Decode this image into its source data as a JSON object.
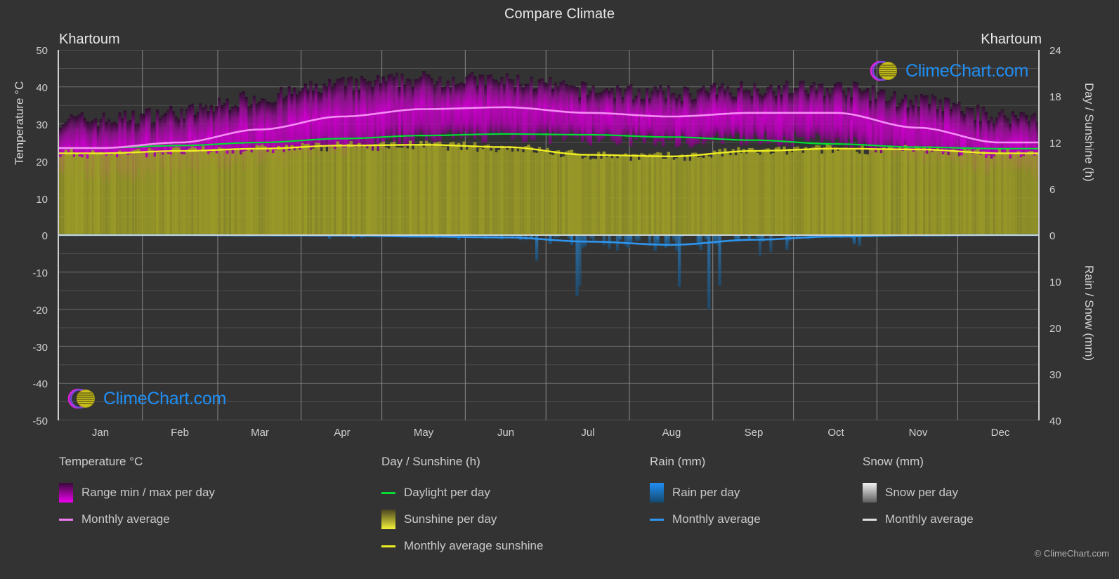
{
  "header": {
    "title": "Compare Climate",
    "location_left": "Khartoum",
    "location_right": "Khartoum"
  },
  "watermark": {
    "text": "ClimeChart.com",
    "copyright": "© ClimeChart.com"
  },
  "axes": {
    "left_label": "Temperature °C",
    "right_label_top": "Day / Sunshine (h)",
    "right_label_bottom": "Rain / Snow (mm)",
    "left_ticks": [
      "50",
      "40",
      "30",
      "20",
      "10",
      "0",
      "-10",
      "-20",
      "-30",
      "-40",
      "-50"
    ],
    "right_ticks_top": [
      "24",
      "18",
      "12",
      "6",
      "0"
    ],
    "right_ticks_bottom": [
      "10",
      "20",
      "30",
      "40"
    ],
    "x_ticks": [
      "Jan",
      "Feb",
      "Mar",
      "Apr",
      "May",
      "Jun",
      "Jul",
      "Aug",
      "Sep",
      "Oct",
      "Nov",
      "Dec"
    ]
  },
  "legend": {
    "temperature": {
      "heading": "Temperature °C",
      "items": [
        {
          "label": "Range min / max per day",
          "type": "swatch",
          "color": "#ee00ee"
        },
        {
          "label": "Monthly average",
          "type": "line",
          "color": "#f07cf0"
        }
      ]
    },
    "day_sunshine": {
      "heading": "Day / Sunshine (h)",
      "items": [
        {
          "label": "Daylight per day",
          "type": "line",
          "color": "#00dd33"
        },
        {
          "label": "Sunshine per day",
          "type": "swatch",
          "color": "#eeee22"
        },
        {
          "label": "Monthly average sunshine",
          "type": "line",
          "color": "#eeee22"
        }
      ]
    },
    "rain": {
      "heading": "Rain (mm)",
      "items": [
        {
          "label": "Rain per day",
          "type": "swatch",
          "color": "#1f8ff5"
        },
        {
          "label": "Monthly average",
          "type": "line",
          "color": "#2f95ee"
        }
      ]
    },
    "snow": {
      "heading": "Snow (mm)",
      "items": [
        {
          "label": "Snow per day",
          "type": "swatch",
          "color": "#e8e8e8"
        },
        {
          "label": "Monthly average",
          "type": "line",
          "color": "#e0e0e0"
        }
      ]
    }
  },
  "colors": {
    "background": "#333333",
    "grid": "#6e6e6e",
    "axis": "#cfcfcf",
    "temp_band": "#cc00cc",
    "temp_avg": "#f58ef5",
    "daylight": "#00dd33",
    "sunshine_fill": "#999922",
    "sunshine_avg": "#eeee22",
    "rain": "#1f6fae",
    "rain_avg": "#2f95ee",
    "logo_blue": "#1f8ff5",
    "logo_magenta": "#e020e0",
    "logo_yellow": "#d8d020"
  },
  "chart_data": {
    "type": "area",
    "title": "Compare Climate",
    "xlabel": "",
    "ylabel": "Temperature °C",
    "ylim": [
      -50,
      50
    ],
    "ylim_right_hours": [
      0,
      24
    ],
    "ylim_right_precip": [
      0,
      40
    ],
    "grid": true,
    "legend_position": "below",
    "categories": [
      "Jan",
      "Feb",
      "Mar",
      "Apr",
      "May",
      "Jun",
      "Jul",
      "Aug",
      "Sep",
      "Oct",
      "Nov",
      "Dec"
    ],
    "series": [
      {
        "name": "Monthly average temperature (°C)",
        "unit": "°C",
        "color": "#f58ef5",
        "values": [
          23.5,
          25.0,
          28.5,
          32.0,
          34.0,
          34.5,
          33.0,
          32.0,
          33.0,
          33.0,
          29.0,
          25.0
        ]
      },
      {
        "name": "Daily maximum temperature (°C)",
        "unit": "°C",
        "color": "#cc00cc",
        "values": [
          31.0,
          33.0,
          37.0,
          40.5,
          42.0,
          41.5,
          39.0,
          38.0,
          39.5,
          39.5,
          36.0,
          32.0
        ]
      },
      {
        "name": "Daily minimum temperature (°C)",
        "unit": "°C",
        "color": "#cc00cc",
        "values": [
          15.5,
          16.5,
          19.5,
          23.0,
          26.0,
          27.0,
          26.0,
          25.5,
          26.0,
          25.5,
          21.0,
          17.0
        ]
      },
      {
        "name": "Daylight per day (h)",
        "unit": "h",
        "color": "#00dd33",
        "values": [
          11.3,
          11.6,
          12.0,
          12.5,
          12.9,
          13.1,
          13.0,
          12.7,
          12.3,
          11.8,
          11.4,
          11.2
        ]
      },
      {
        "name": "Monthly average sunshine (h)",
        "unit": "h",
        "color": "#eeee22",
        "values": [
          10.6,
          10.9,
          11.2,
          11.6,
          11.7,
          11.4,
          10.4,
          10.2,
          10.9,
          11.2,
          11.1,
          10.6
        ]
      },
      {
        "name": "Monthly average rain (mm/day)",
        "unit": "mm",
        "color": "#2f95ee",
        "values": [
          0.0,
          0.0,
          0.05,
          0.1,
          0.3,
          0.5,
          1.4,
          2.1,
          1.0,
          0.3,
          0.05,
          0.0
        ]
      },
      {
        "name": "Monthly average snow (mm/day)",
        "unit": "mm",
        "color": "#e0e0e0",
        "values": [
          0,
          0,
          0,
          0,
          0,
          0,
          0,
          0,
          0,
          0,
          0,
          0
        ]
      }
    ]
  }
}
